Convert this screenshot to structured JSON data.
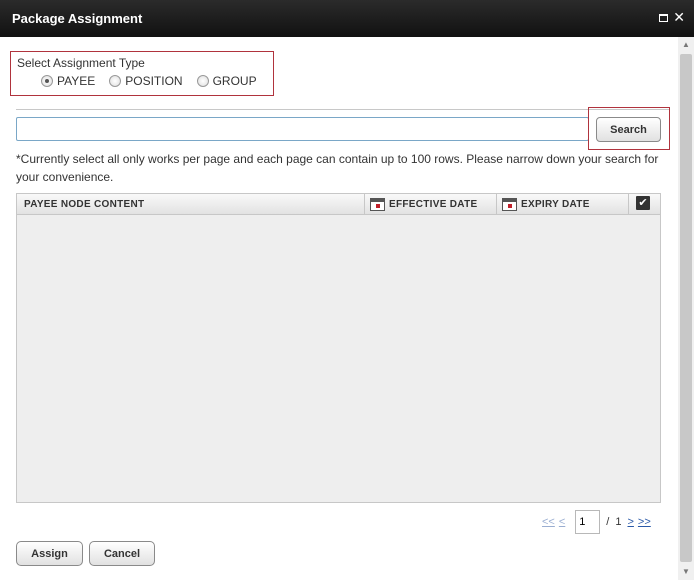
{
  "window": {
    "title": "Package Assignment",
    "maximize_icon": "maximize-icon",
    "close_icon": "close-icon",
    "close_glyph": "✕"
  },
  "assignment_type": {
    "label": "Select Assignment Type",
    "selected": "PAYEE",
    "options": [
      "PAYEE",
      "POSITION",
      "GROUP"
    ]
  },
  "search": {
    "value": "",
    "placeholder": "",
    "button_label": "Search"
  },
  "note": "*Currently select all only works per page and each page can contain up to 100 rows. Please narrow down your search for your convenience.",
  "grid": {
    "columns": [
      "PAYEE NODE CONTENT",
      "EFFECTIVE DATE",
      "EXPIRY DATE"
    ],
    "select_all_checked": true,
    "rows": []
  },
  "pagination": {
    "first": "<<",
    "prev": "<",
    "current_page": "1",
    "separator": "/",
    "total_pages": "1",
    "next": ">",
    "last": ">>"
  },
  "actions": {
    "assign_label": "Assign",
    "cancel_label": "Cancel"
  },
  "colors": {
    "titlebar": "#1a1a1a",
    "highlight_border": "#b0333d",
    "link": "#2a59a8"
  }
}
